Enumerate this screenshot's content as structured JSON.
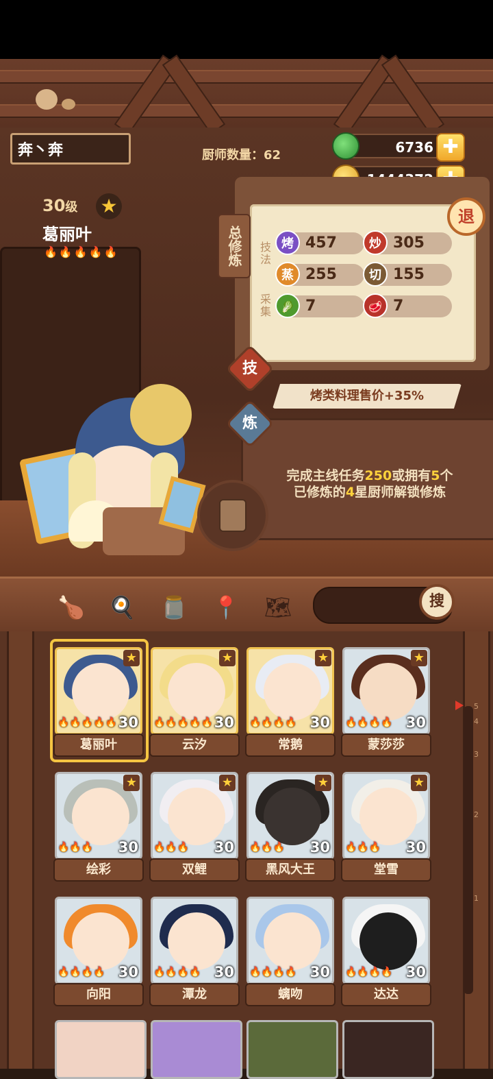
{
  "header": {
    "player_name": "奔丶奔",
    "chef_count_label": "厨师数量：62",
    "jade": "6736",
    "coins": "1444372",
    "plus": "✚"
  },
  "character": {
    "level": "30",
    "level_unit": "级",
    "name": "葛丽叶",
    "flames": "🔥🔥🔥🔥🔥"
  },
  "training_panel": {
    "title": "总修炼",
    "skill_label": "技法",
    "gather_label": "采集",
    "retreat": "退",
    "skills": [
      {
        "icon": "烤",
        "value": "457",
        "color": "#7a4fc4"
      },
      {
        "icon": "炒",
        "value": "305",
        "color": "#c0392b"
      },
      {
        "icon": "蒸",
        "value": "255",
        "color": "#e08a2a"
      },
      {
        "icon": "切",
        "value": "155",
        "color": "#7b5a34"
      },
      {
        "icon": "🥬",
        "value": "7",
        "color": "#4f9a2e"
      },
      {
        "icon": "🥩",
        "value": "7",
        "color": "#b8322a"
      }
    ],
    "tab_skill": "技",
    "tab_train": "炼",
    "bonus": "烤类料理售价+35%",
    "lock_line1_a": "完成主线任务",
    "lock_line1_b": "250",
    "lock_line1_c": "或拥有",
    "lock_line1_d": "5",
    "lock_line1_e": "个",
    "lock_line2_a": "已修炼的",
    "lock_line2_b": "4",
    "lock_line2_c": "星厨师解锁修炼"
  },
  "toolbar": {
    "search_label": "搜"
  },
  "slider_ticks": [
    "5",
    "4",
    "3",
    "2",
    "1"
  ],
  "chefs": [
    {
      "name": "葛丽叶",
      "level": "30",
      "flames": "🔥🔥🔥🔥🔥",
      "gold": true,
      "starred": true,
      "hair": "#3d5a8f",
      "skin": "#fbe4d0"
    },
    {
      "name": "云汐",
      "level": "30",
      "flames": "🔥🔥🔥🔥🔥",
      "gold": true,
      "starred": true,
      "hair": "#f3dc8a",
      "skin": "#fbe4d0"
    },
    {
      "name": "常鹅",
      "level": "30",
      "flames": "🔥🔥🔥🔥",
      "gold": true,
      "starred": true,
      "hair": "#e8ecf4",
      "skin": "#fbe4d0"
    },
    {
      "name": "蒙莎莎",
      "level": "30",
      "flames": "🔥🔥🔥🔥",
      "gold": false,
      "starred": true,
      "hair": "#5a2e1e",
      "skin": "#f6dcc4"
    },
    {
      "name": "绘彩",
      "level": "30",
      "flames": "🔥🔥🔥",
      "gold": false,
      "starred": true,
      "hair": "#b9bfb8",
      "skin": "#fbe4d0"
    },
    {
      "name": "双鲤",
      "level": "30",
      "flames": "🔥🔥🔥",
      "gold": false,
      "starred": true,
      "hair": "#f1eef2",
      "skin": "#fbe4d0"
    },
    {
      "name": "黑风大王",
      "level": "30",
      "flames": "🔥🔥🔥",
      "gold": false,
      "starred": true,
      "hair": "#2a2522",
      "skin": "#3a3330"
    },
    {
      "name": "堂雪",
      "level": "30",
      "flames": "🔥🔥🔥",
      "gold": false,
      "starred": true,
      "hair": "#f2efe8",
      "skin": "#fbe4d0"
    },
    {
      "name": "向阳",
      "level": "30",
      "flames": "🔥🔥🔥🔥",
      "gold": false,
      "starred": false,
      "hair": "#f08a2c",
      "skin": "#fbe4d0"
    },
    {
      "name": "潭龙",
      "level": "30",
      "flames": "🔥🔥🔥🔥",
      "gold": false,
      "starred": false,
      "hair": "#1f2c4e",
      "skin": "#fbe4d0"
    },
    {
      "name": "螭吻",
      "level": "30",
      "flames": "🔥🔥🔥🔥",
      "gold": false,
      "starred": false,
      "hair": "#a9c7ea",
      "skin": "#fbe4d0"
    },
    {
      "name": "达达",
      "level": "30",
      "flames": "🔥🔥🔥🔥",
      "gold": false,
      "starred": false,
      "hair": "#f5f5f5",
      "skin": "#1e1e1e"
    }
  ]
}
